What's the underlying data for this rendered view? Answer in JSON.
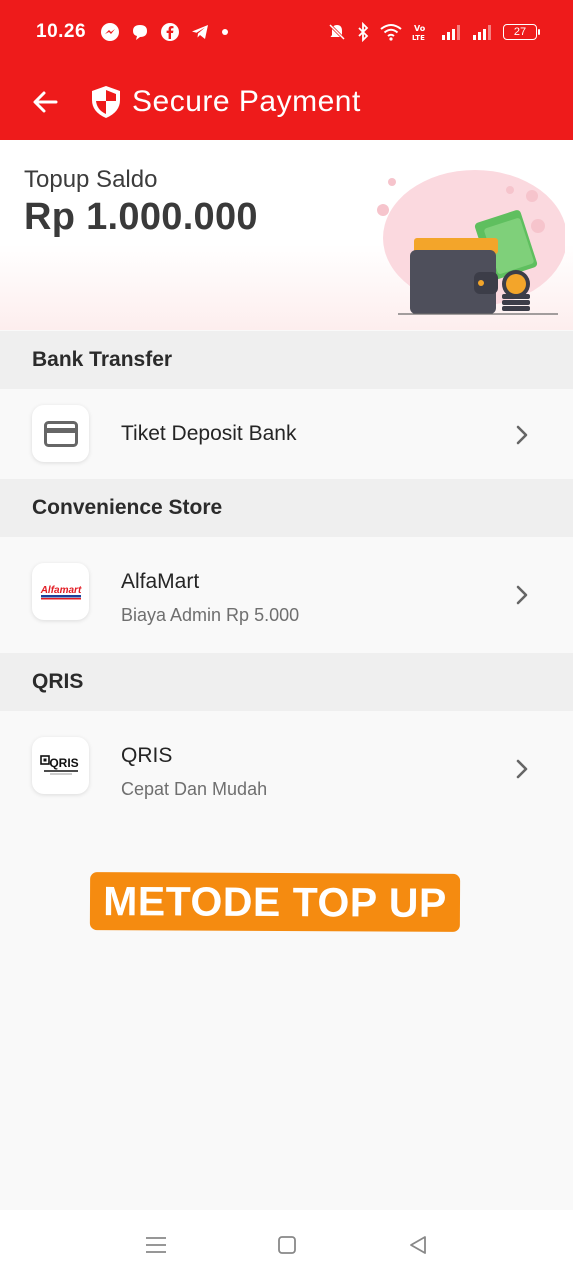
{
  "status_bar": {
    "time": "10.26",
    "notification_icons": [
      "messenger-icon",
      "chat-bubble-icon",
      "facebook-icon",
      "telegram-icon",
      "more-dot-icon"
    ],
    "battery_level": "27"
  },
  "app_bar": {
    "title": "Secure Payment"
  },
  "topup": {
    "label": "Topup Saldo",
    "amount": "Rp 1.000.000"
  },
  "sections": {
    "bank_transfer": {
      "title": "Bank Transfer",
      "item": {
        "name": "Tiket Deposit Bank",
        "icon": "credit-card-icon"
      }
    },
    "convenience_store": {
      "title": "Convenience Store",
      "item": {
        "name": "AlfaMart",
        "subtitle": "Biaya Admin Rp 5.000",
        "logo_text": "Alfamart"
      }
    },
    "qris": {
      "title": "QRIS",
      "item": {
        "name": "QRIS",
        "subtitle": "Cepat Dan Mudah",
        "logo_text": "QRIS"
      }
    }
  },
  "stamp": {
    "text": "METODE TOP UP",
    "color": "#f58b10"
  },
  "colors": {
    "brand_red": "#ee1b1b",
    "section_bg": "#efefef",
    "page_bg": "#f9f9f9"
  }
}
